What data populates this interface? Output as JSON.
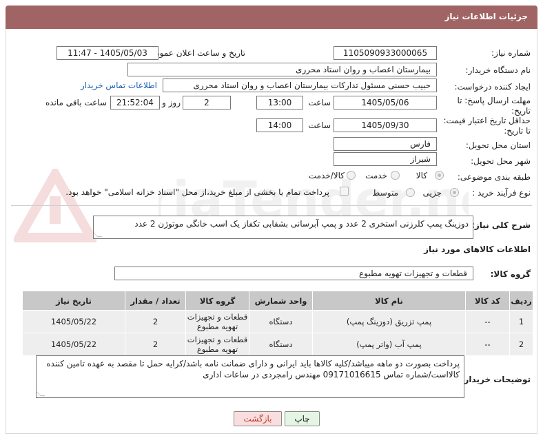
{
  "header": {
    "title": "جزئیات اطلاعات نیاز"
  },
  "fields": {
    "need_number_label": "شماره نیاز:",
    "need_number": "1105090933000065",
    "announce_label": "تاریخ و ساعت اعلان عمومی:",
    "announce_value": "1405/05/03 - 11:47",
    "buyer_org_label": "نام دستگاه خریدار:",
    "buyer_org": "بیمارستان اعصاب و روان استاد محرری",
    "creator_label": "ایجاد کننده درخواست:",
    "creator": "حبیب حسنی مسئول تدارکات بیمارستان اعصاب و روان استاد محرری",
    "contact_link": "اطلاعات تماس خریدار",
    "deadline_label_1": "مهلت ارسال پاسخ: تا",
    "deadline_label_2": "تاریخ:",
    "deadline_date": "1405/05/06",
    "time_label": "ساعت",
    "deadline_time": "13:00",
    "days_value": "2",
    "days_label": "روز و",
    "remaining_time": "21:52:04",
    "remaining_label": "ساعت باقی مانده",
    "price_valid_label_1": "حداقل تاریخ اعتبار قیمت:",
    "price_valid_label_2": "تا تاریخ:",
    "price_valid_date": "1405/09/30",
    "price_valid_time": "14:00",
    "province_label": "استان محل تحویل:",
    "province": "فارس",
    "city_label": "شهر محل تحویل:",
    "city": "شیراز",
    "category_label": "طبقه بندی موضوعی:",
    "category_options": [
      "کالا",
      "خدمت",
      "کالا/خدمت"
    ],
    "process_label": "نوع فرآیند خرید :",
    "process_options": [
      "جزیی",
      "متوسط"
    ],
    "payment_note": "پرداخت تمام یا بخشی از مبلغ خرید،از محل \"اسناد خزانه اسلامی\" خواهد بود.",
    "description_label": "شرح کلی نیاز:",
    "description": "دوزینگ پمپ کلرزنی استخری 2 عدد و پمپ آبرسانی بشقابی تکفاز یک اسب خانگی موتوژن 2 عدد",
    "goods_info_label": "اطلاعات کالاهای مورد نیاز",
    "goods_group_label": "گروه کالا:",
    "goods_group": "قطعات و تجهیزات تهویه مطبوع",
    "buyer_notes_label": "توضیحات خریدار:",
    "buyer_notes": "پرداخت بصورت دو ماهه میباشد/کلیه کالاها باید ایرانی و دارای ضمانت نامه باشد/کرایه حمل تا مقصد به عهده تامین کننده کالااست/شماره تماس 09171016615 مهندس رامجردی در ساعات اداری"
  },
  "table": {
    "headers": [
      "ردیف",
      "کد کالا",
      "نام کالا",
      "واحد شمارش",
      "گروه کالا",
      "تعداد / مقدار",
      "تاریخ نیاز"
    ],
    "rows": [
      [
        "1",
        "--",
        "پمپ تزریق (دوزینگ پمپ)",
        "دستگاه",
        "قطعات و تجهیزات تهویه مطبوع",
        "2",
        "1405/05/22"
      ],
      [
        "2",
        "--",
        "پمپ آب (واتر پمپ)",
        "دستگاه",
        "قطعات و تجهیزات تهویه مطبوع",
        "2",
        "1405/05/22"
      ]
    ]
  },
  "buttons": {
    "print": "چاپ",
    "back": "بازگشت"
  },
  "watermark": {
    "text": "AriaTender.net"
  },
  "colors": {
    "titlebar": "#a06464",
    "link": "#1a5fb4",
    "table_header": "#c8c8c8",
    "table_row": "#eeeeee",
    "print_btn": "#e4f5e4",
    "back_btn": "#f8dede"
  }
}
